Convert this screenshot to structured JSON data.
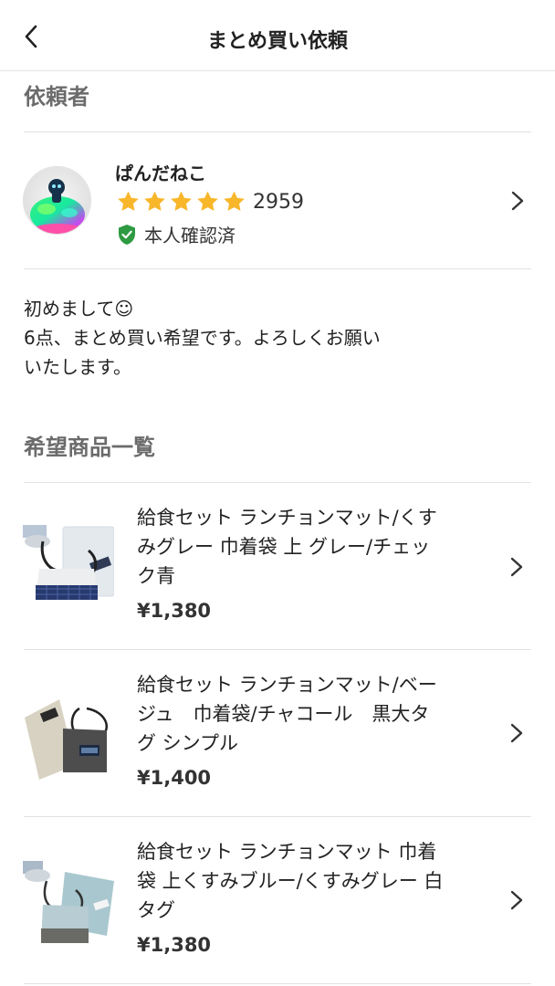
{
  "header": {
    "back_icon": "chevron-left-icon",
    "title": "まとめ買い依頼"
  },
  "requester_section": {
    "title": "依頼者",
    "name": "ぱんだねこ",
    "rating_stars": 5,
    "rating_count": "2959",
    "verified_label": "本人確認済",
    "colors": {
      "star": "#F8B62A",
      "verified": "#2E9A42"
    }
  },
  "message": {
    "lines": [
      "初めまして☺︎",
      "6点、まとめ買い希望です。よろしくお願い",
      "いたします。"
    ]
  },
  "items_section": {
    "title": "希望商品一覧",
    "items": [
      {
        "title": "給食セット ランチョンマット/くすみグレー 巾着袋 上 グレー/チェック青",
        "title_lines": [
          "給食セット ランチョンマット/くす",
          "みグレー 巾着袋 上 グレー/チェッ",
          "ク青"
        ],
        "price": "¥1,380"
      },
      {
        "title": "給食セット ランチョンマット/ベージュ　巾着袋/チャコール　黒大タグ シンプル",
        "title_lines": [
          "給食セット ランチョンマット/ベー",
          "ジュ　巾着袋/チャコール　黒大タ",
          "グ シンプル"
        ],
        "price": "¥1,400"
      },
      {
        "title": "給食セット ランチョンマット 巾着袋 上くすみブルー/くすみグレー 白タグ",
        "title_lines": [
          "給食セット ランチョンマット 巾着",
          "袋 上くすみブルー/くすみグレー 白",
          "タグ"
        ],
        "price": "¥1,380"
      }
    ]
  }
}
